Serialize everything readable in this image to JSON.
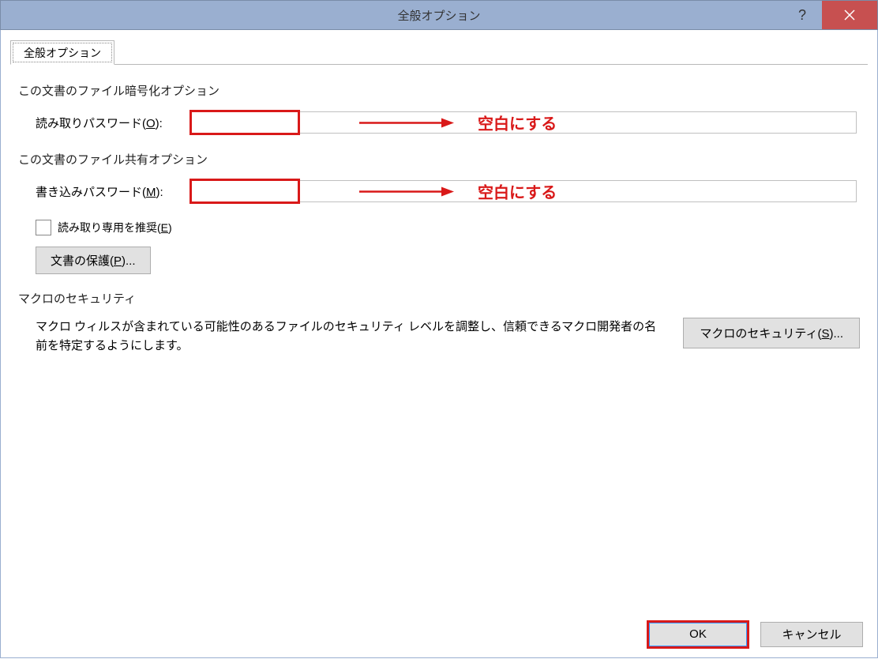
{
  "titlebar": {
    "title": "全般オプション"
  },
  "tab": {
    "label": "全般オプション"
  },
  "sections": {
    "encryption": {
      "title": "この文書のファイル暗号化オプション",
      "read_password_label_pre": "読み取りパスワード(",
      "read_password_accel": "O",
      "read_password_label_post": "):",
      "read_password_value": ""
    },
    "sharing": {
      "title": "この文書のファイル共有オプション",
      "write_password_label_pre": "書き込みパスワード(",
      "write_password_accel": "M",
      "write_password_label_post": "):",
      "write_password_value": "",
      "readonly_checkbox_label_pre": "読み取り専用を推奨(",
      "readonly_checkbox_accel": "E",
      "readonly_checkbox_label_post": ")",
      "protect_button_label_pre": "文書の保護(",
      "protect_button_accel": "P",
      "protect_button_label_post": ")..."
    },
    "macro": {
      "title": "マクロのセキュリティ",
      "description": "マクロ ウィルスが含まれている可能性のあるファイルのセキュリティ レベルを調整し、信頼できるマクロ開発者の名前を特定するようにします。",
      "button_label_pre": "マクロのセキュリティ(",
      "button_accel": "S",
      "button_label_post": ")..."
    }
  },
  "annotations": {
    "blank_text": "空白にする"
  },
  "footer": {
    "ok_label": "OK",
    "cancel_label": "キャンセル"
  }
}
